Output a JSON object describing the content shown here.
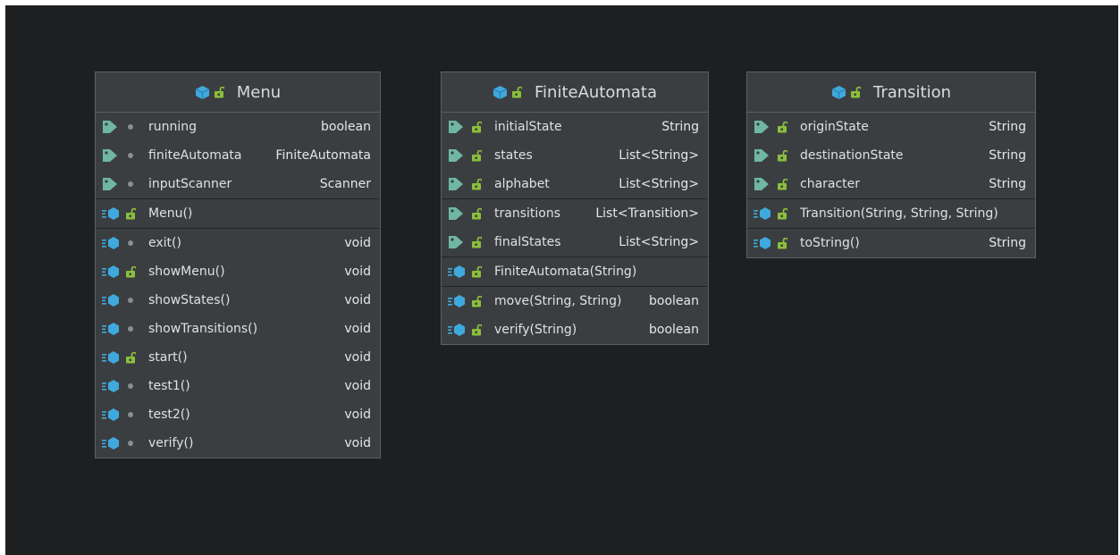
{
  "classes": [
    {
      "name": "Menu",
      "sections": [
        [
          {
            "kind": "field",
            "visibility": "private",
            "name": "running",
            "type": "boolean"
          },
          {
            "kind": "field",
            "visibility": "private",
            "name": "finiteAutomata",
            "type": "FiniteAutomata"
          },
          {
            "kind": "field",
            "visibility": "private",
            "name": "inputScanner",
            "type": "Scanner"
          }
        ],
        [
          {
            "kind": "constructor",
            "visibility": "public",
            "name": "Menu()",
            "type": ""
          }
        ],
        [
          {
            "kind": "method",
            "visibility": "private",
            "name": "exit()",
            "type": "void"
          },
          {
            "kind": "method",
            "visibility": "public",
            "name": "showMenu()",
            "type": "void"
          },
          {
            "kind": "method",
            "visibility": "private",
            "name": "showStates()",
            "type": "void"
          },
          {
            "kind": "method",
            "visibility": "private",
            "name": "showTransitions()",
            "type": "void"
          },
          {
            "kind": "method",
            "visibility": "public",
            "name": "start()",
            "type": "void"
          },
          {
            "kind": "method",
            "visibility": "private",
            "name": "test1()",
            "type": "void"
          },
          {
            "kind": "method",
            "visibility": "private",
            "name": "test2()",
            "type": "void"
          },
          {
            "kind": "method",
            "visibility": "private",
            "name": "verify()",
            "type": "void"
          }
        ]
      ]
    },
    {
      "name": "FiniteAutomata",
      "sections": [
        [
          {
            "kind": "field",
            "visibility": "public",
            "name": "initialState",
            "type": "String"
          },
          {
            "kind": "field",
            "visibility": "public",
            "name": "states",
            "type": "List<String>"
          },
          {
            "kind": "field",
            "visibility": "public",
            "name": "alphabet",
            "type": "List<String>"
          }
        ],
        [
          {
            "kind": "field",
            "visibility": "public",
            "name": "transitions",
            "type": "List<Transition>"
          },
          {
            "kind": "field",
            "visibility": "public",
            "name": "finalStates",
            "type": "List<String>"
          }
        ],
        [
          {
            "kind": "constructor",
            "visibility": "public",
            "name": "FiniteAutomata(String)",
            "type": ""
          }
        ],
        [
          {
            "kind": "method",
            "visibility": "public",
            "name": "move(String, String)",
            "type": "boolean"
          },
          {
            "kind": "method",
            "visibility": "public",
            "name": "verify(String)",
            "type": "boolean"
          }
        ]
      ]
    },
    {
      "name": "Transition",
      "sections": [
        [
          {
            "kind": "field",
            "visibility": "public",
            "name": "originState",
            "type": "String"
          },
          {
            "kind": "field",
            "visibility": "public",
            "name": "destinationState",
            "type": "String"
          },
          {
            "kind": "field",
            "visibility": "public",
            "name": "character",
            "type": "String"
          }
        ],
        [
          {
            "kind": "constructor",
            "visibility": "public",
            "name": "Transition(String, String, String)",
            "type": ""
          }
        ],
        [
          {
            "kind": "method",
            "visibility": "public",
            "name": "toString()",
            "type": "String"
          }
        ]
      ]
    }
  ],
  "colors": {
    "background": "#1e1f21",
    "class_box": "#3b3e40",
    "class_icon": "#3fa9dd",
    "field_tag": "#6fb7a1",
    "public_lock": "#8bbf3c",
    "private_dot": "#8b8e91"
  }
}
